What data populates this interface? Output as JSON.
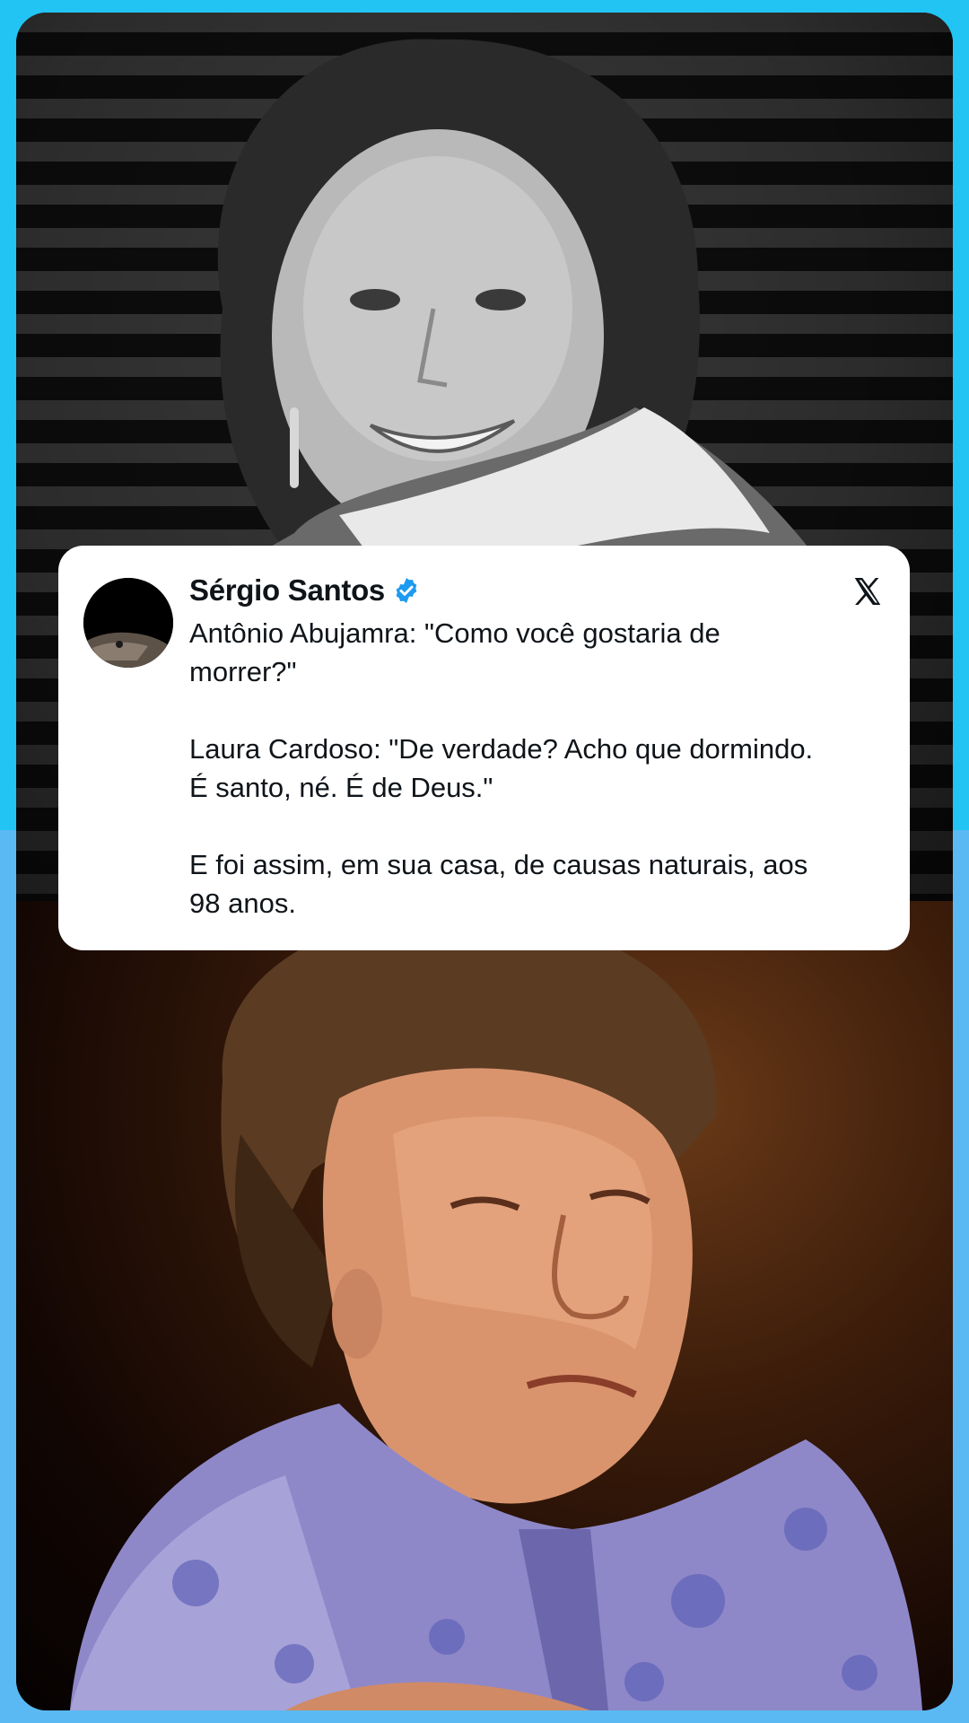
{
  "tweet": {
    "author_name": "Sérgio Santos",
    "verified": true,
    "lines": [
      "Antônio Abujamra: \"Como você gostaria de",
      "morrer?\"",
      "",
      "Laura Cardoso: \"De verdade? Acho que dormindo.",
      "É santo, né. É de Deus.\"",
      "",
      "E foi assim, em sua casa, de causas naturais, aos",
      "98 anos."
    ],
    "platform_icon": "x-logo-icon",
    "badge_icon": "verified-badge-icon"
  },
  "colors": {
    "background_top": "#22c4f4",
    "background_bottom": "#5ab9f2",
    "card": "#ffffff",
    "text": "#0f1419",
    "verified": "#1d9bf0"
  }
}
